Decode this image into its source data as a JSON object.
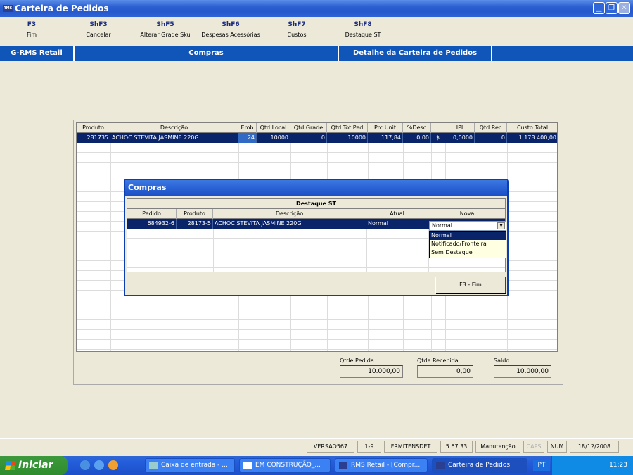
{
  "window": {
    "title": "Carteira de Pedidos",
    "app_icon_text": "RMS"
  },
  "fkeys": [
    {
      "key": "F3",
      "label": "Fim"
    },
    {
      "key": "ShF3",
      "label": "Cancelar"
    },
    {
      "key": "ShF5",
      "label": "Alterar Grade Sku"
    },
    {
      "key": "ShF6",
      "label": "Despesas Acessórias"
    },
    {
      "key": "ShF7",
      "label": "Custos"
    },
    {
      "key": "ShF8",
      "label": "Destaque ST"
    }
  ],
  "navbar": {
    "system": "G-RMS Retail",
    "module": "Compras",
    "screen": "Detalhe da Carteira de Pedidos"
  },
  "grid": {
    "headers": [
      "Produto",
      "Descrição",
      "Emb",
      "Qtd Local",
      "Qtd Grade",
      "Qtd Tot Ped",
      "Prc Unit",
      "%Desc",
      "",
      "IPI",
      "Qtd Rec",
      "Custo Total"
    ],
    "row": {
      "produto": "281735",
      "descricao": "ACHOC STEVITA JASMINE 220G",
      "emb": "24",
      "qtd_local": "10000",
      "qtd_grade": "0",
      "qtd_tot_ped": "10000",
      "prc_unit": "117,84",
      "desc": "0,00",
      "currency": "$",
      "ipi": "0,0000",
      "qtd_rec": "0",
      "custo_total": "1.178.400,00"
    }
  },
  "totals": {
    "qtde_pedida": {
      "label": "Qtde Pedida",
      "value": "10.000,00"
    },
    "qtde_recebida": {
      "label": "Qtde Recebida",
      "value": "0,00"
    },
    "saldo": {
      "label": "Saldo",
      "value": "10.000,00"
    }
  },
  "dialog": {
    "title": "Compras",
    "caption": "Destaque ST",
    "headers": [
      "Pedido",
      "Produto",
      "Descrição",
      "Atual",
      "Nova"
    ],
    "row": {
      "pedido": "684932-6",
      "produto": "28173-5",
      "descricao": "ACHOC STEVITA JASMINE 220G",
      "atual": "Normal"
    },
    "combo_value": "Normal",
    "options": [
      "Normal",
      "Notificado/Fronteira",
      "Sem Destaque"
    ],
    "selected_option": "Normal",
    "button": "F3 - Fim"
  },
  "statusbar": [
    "VERSAO567",
    "1-9",
    "FRMITENSDET",
    "5.67.33",
    "Manutenção",
    "CAPS",
    "NUM",
    "18/12/2008"
  ],
  "taskbar": {
    "start": "Iniciar",
    "buttons": [
      "Caixa de entrada - ...",
      "EM CONSTRUÇÃO_...",
      "RMS Retail - [Compr...",
      "Carteira de Pedidos"
    ],
    "lang": "PT",
    "clock": "11:23"
  },
  "colors": {
    "accent": "#1055b8",
    "selection": "#0a246a",
    "title_gradient": "#2559cc"
  }
}
